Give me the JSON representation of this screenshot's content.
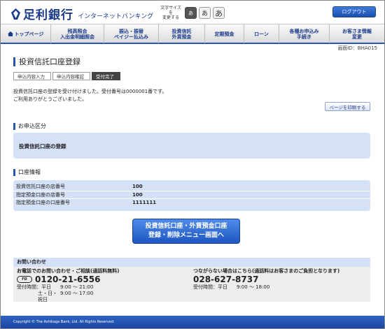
{
  "header": {
    "bank_name": "足利銀行",
    "service_name": "インターネットバンキング",
    "text_size_label_line1": "文字サイズを",
    "text_size_label_line2": "変更する",
    "text_size_options": [
      "あ",
      "あ",
      "あ"
    ],
    "logout_label": "ログアウト"
  },
  "nav": {
    "items": [
      {
        "line1": "トップページ",
        "line2": ""
      },
      {
        "line1": "残高照会",
        "line2": "入出金明細照会"
      },
      {
        "line1": "振込・振替",
        "line2": "ペイジー払込み"
      },
      {
        "line1": "投資信託",
        "line2": "外貨預金"
      },
      {
        "line1": "定期預金",
        "line2": ""
      },
      {
        "line1": "ローン",
        "line2": ""
      },
      {
        "line1": "各種お申込み",
        "line2": "手続き"
      },
      {
        "line1": "お客さま情報",
        "line2": "変更"
      }
    ]
  },
  "screen_id": "画面ID：BHA015",
  "page_title": "投資信託口座登録",
  "steps": [
    {
      "label": "申込内容入力",
      "done": false
    },
    {
      "label": "申込内容確認",
      "done": false
    },
    {
      "label": "受付完了",
      "done": true
    }
  ],
  "message": {
    "line1": "投資信託口座の登録を受け付けました。受付番号は0000001番です。",
    "line2": "ご利用ありがとうございました。"
  },
  "print_label": "ページを印刷する",
  "application": {
    "section_title": "お申込区分",
    "type": "投資信託口座の登録"
  },
  "account": {
    "section_title": "口座情報",
    "rows": [
      {
        "label": "投資信託口座の店番号",
        "value": "100"
      },
      {
        "label": "指定預金口座の店番号",
        "value": "100"
      },
      {
        "label": "指定預金口座の口座番号",
        "value": "1111111"
      }
    ]
  },
  "menu_button": {
    "line1": "投資信託口座・外貨預金口座",
    "line2": "登録・削除メニュー画面へ"
  },
  "contact": {
    "title": "お問い合わせ",
    "left": {
      "heading": "お電話でのお問い合わせ・ご相談(通話料無料)",
      "icon": "free-dial-icon",
      "phone": "0120-21-6556",
      "hours_label": "受付時間：平日",
      "hours_value": "9:00 ～ 21:00",
      "hours_label2": "土・日・祝日",
      "hours_value2": "9:00 ～ 17:00"
    },
    "right": {
      "heading": "つながらない場合はこちら(通話料はお客さまのご負担となります)",
      "phone": "028-627-8737",
      "hours_label": "受付時間：平日",
      "hours_value": "9:00 ～ 18:00"
    }
  },
  "footer": {
    "copyright": "Copyright © The Ashikaga Bank, Ltd. All Rights Reserved."
  },
  "colors": {
    "brand": "#1a3a8c",
    "accent": "#2a55b0",
    "panel": "#d5e1f7"
  }
}
